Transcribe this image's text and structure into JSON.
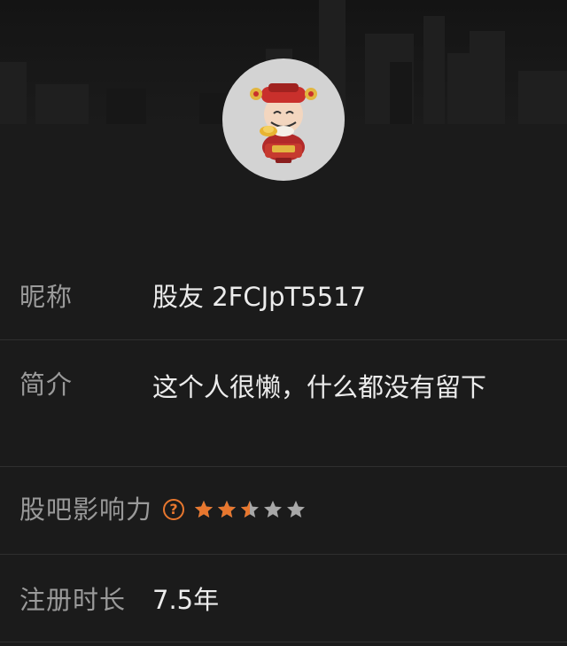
{
  "profile": {
    "avatar_icon": "god-of-wealth-avatar-icon",
    "nickname_label": "昵称",
    "nickname": "股友 2FCJpT5517",
    "intro_label": "简介",
    "intro": "这个人很懒，什么都没有留下",
    "influence_label": "股吧影响力",
    "influence_help_icon": "question-circle-icon",
    "influence_help_glyph": "?",
    "influence_rating": 2.5,
    "influence_max": 5,
    "reg_label": "注册时长",
    "reg_value": "7.5年"
  },
  "colors": {
    "background": "#1b1b1b",
    "divider": "#2f2f2f",
    "star_active": "#e8772e",
    "star_inactive": "#a8a8a8",
    "label": "#9a9a9a",
    "value": "#ececec"
  }
}
